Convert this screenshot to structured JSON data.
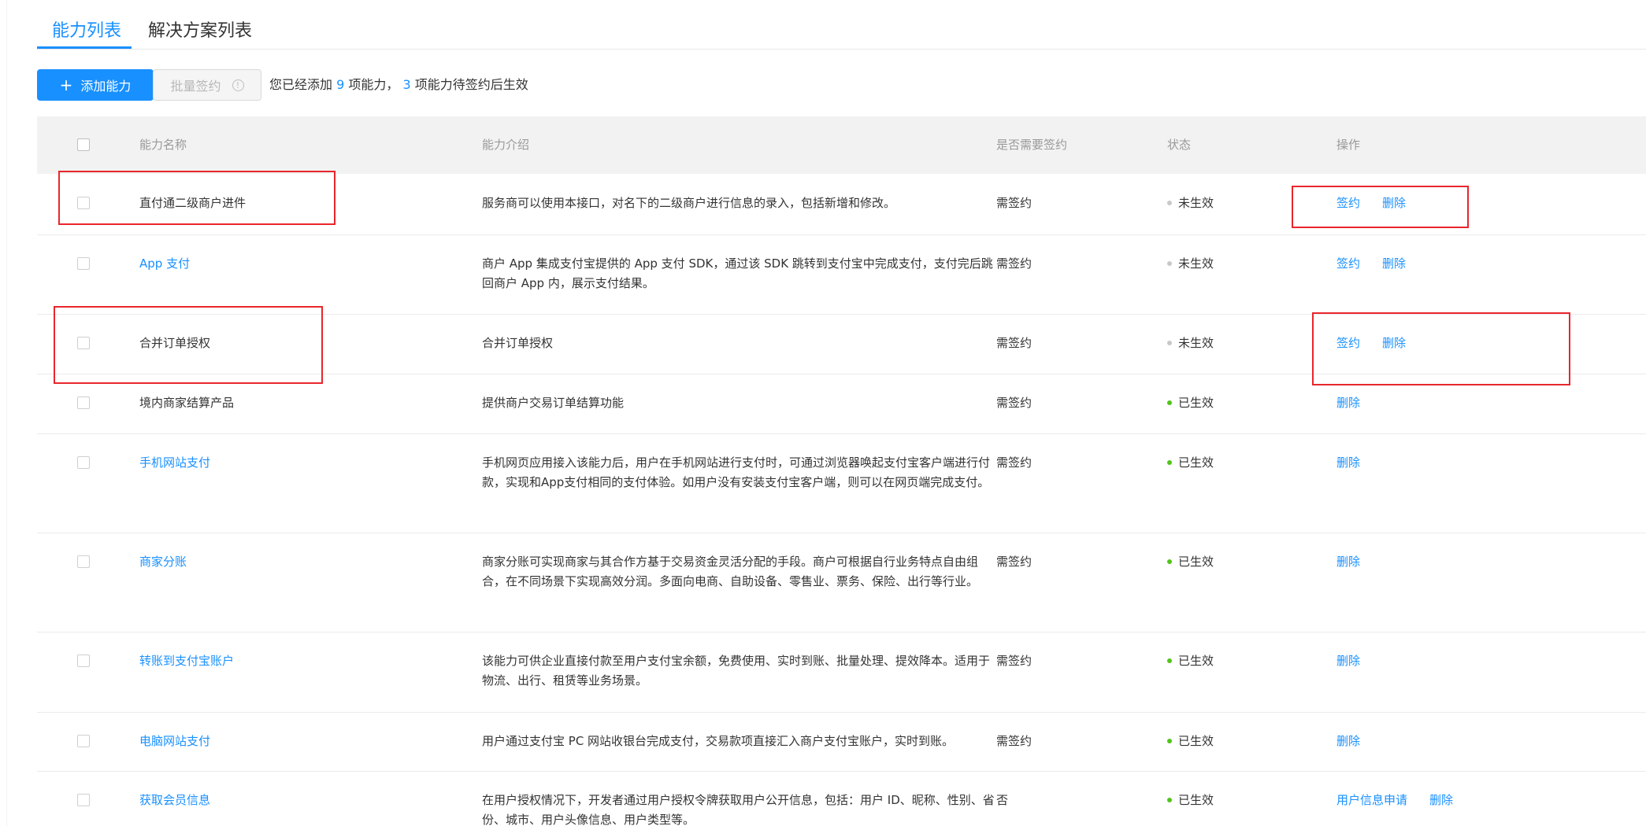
{
  "tabs": [
    {
      "label": "能力列表",
      "active": true
    },
    {
      "label": "解决方案列表",
      "active": false
    }
  ],
  "toolbar": {
    "add_label": "添加能力",
    "batch_sign_label": "批量签约",
    "summary": {
      "prefix": "您已经添加",
      "added_count": "9",
      "middle": "项能力，",
      "pending_count": "3",
      "suffix": "项能力待签约后生效"
    }
  },
  "table": {
    "columns": [
      "能力名称",
      "能力介绍",
      "是否需要签约",
      "状态",
      "操作"
    ],
    "rows": [
      {
        "name": "直付通二级商户进件",
        "name_is_link": false,
        "desc": "服务商可以使用本接口，对名下的二级商户进行信息的录入，包括新增和修改。",
        "sign": "需签约",
        "status": "未生效",
        "status_color": "#c8c8c8",
        "ops": [
          "签约",
          "删除"
        ]
      },
      {
        "name": "App 支付",
        "name_is_link": true,
        "desc": "商户 App 集成支付宝提供的 App 支付 SDK，通过该 SDK 跳转到支付宝中完成支付，支付完后跳回商户 App 内，展示支付结果。",
        "sign": "需签约",
        "status": "未生效",
        "status_color": "#c8c8c8",
        "ops": [
          "签约",
          "删除"
        ]
      },
      {
        "name": "合并订单授权",
        "name_is_link": false,
        "desc": "合并订单授权",
        "sign": "需签约",
        "status": "未生效",
        "status_color": "#c8c8c8",
        "ops": [
          "签约",
          "删除"
        ]
      },
      {
        "name": "境内商家结算产品",
        "name_is_link": false,
        "desc": "提供商户交易订单结算功能",
        "sign": "需签约",
        "status": "已生效",
        "status_color": "#52c41a",
        "ops": [
          "删除"
        ]
      },
      {
        "name": "手机网站支付",
        "name_is_link": true,
        "desc": "手机网页应用接入该能力后，用户在手机网站进行支付时，可通过浏览器唤起支付宝客户端进行付款，实现和App支付相同的支付体验。如用户没有安装支付宝客户端，则可以在网页端完成支付。",
        "sign": "需签约",
        "status": "已生效",
        "status_color": "#52c41a",
        "ops": [
          "删除"
        ]
      },
      {
        "name": "商家分账",
        "name_is_link": true,
        "desc": "商家分账可实现商家与其合作方基于交易资金灵活分配的手段。商户可根据自行业务特点自由组合，在不同场景下实现高效分润。多面向电商、自助设备、零售业、票务、保险、出行等行业。",
        "sign": "需签约",
        "status": "已生效",
        "status_color": "#52c41a",
        "ops": [
          "删除"
        ]
      },
      {
        "name": "转账到支付宝账户",
        "name_is_link": true,
        "desc": "该能力可供企业直接付款至用户支付宝余额，免费使用、实时到账、批量处理、提效降本。适用于物流、出行、租赁等业务场景。",
        "sign": "需签约",
        "status": "已生效",
        "status_color": "#52c41a",
        "ops": [
          "删除"
        ]
      },
      {
        "name": "电脑网站支付",
        "name_is_link": true,
        "desc": "用户通过支付宝 PC 网站收银台完成支付，交易款项直接汇入商户支付宝账户，实时到账。",
        "sign": "需签约",
        "status": "已生效",
        "status_color": "#52c41a",
        "ops": [
          "删除"
        ]
      },
      {
        "name": "获取会员信息",
        "name_is_link": true,
        "desc": "在用户授权情况下，开发者通过用户授权令牌获取用户公开信息，包括：用户 ID、昵称、性别、省份、城市、用户头像信息、用户类型等。",
        "sign": "否",
        "status": "已生效",
        "status_color": "#52c41a",
        "ops": [
          "用户信息申请",
          "删除"
        ]
      }
    ]
  },
  "colors": {
    "primary": "#1890ff",
    "active_status": "#52c41a",
    "inactive_status": "#c8c8c8",
    "annotation_red": "#e8262c"
  },
  "icons": {
    "add": "plus-icon",
    "batch_info": "info-circle-icon",
    "status": "status-dot-icon"
  }
}
